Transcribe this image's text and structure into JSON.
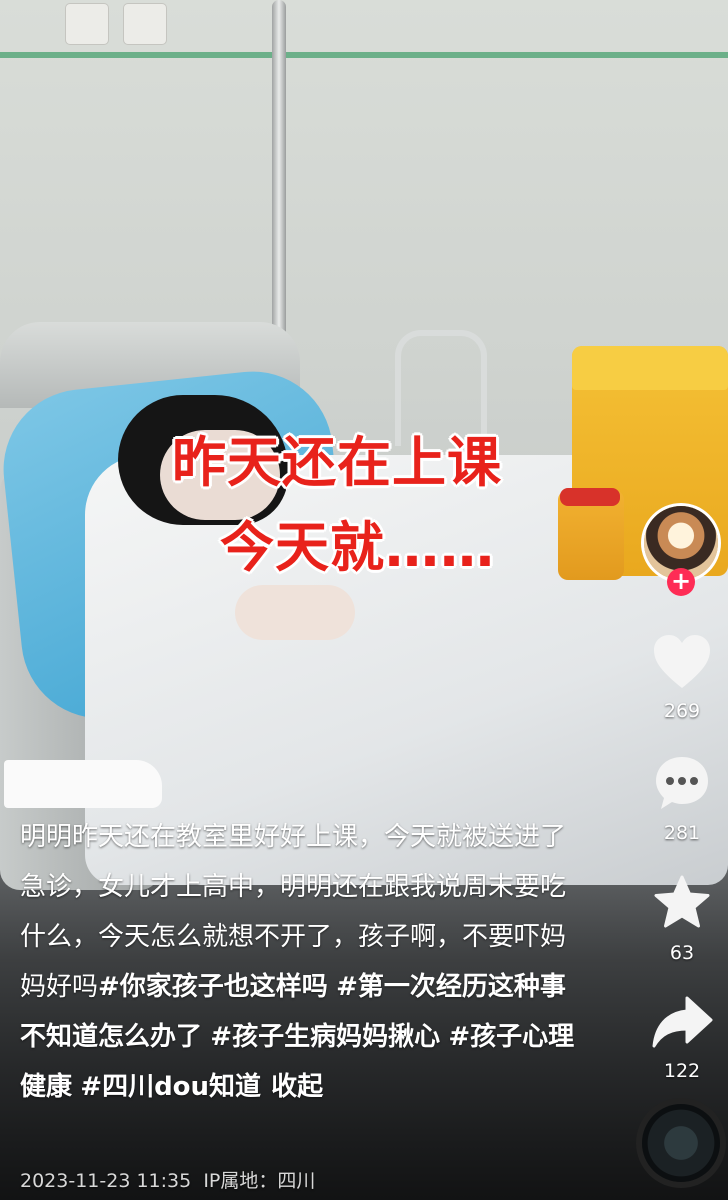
{
  "video": {
    "overlay_line1": "昨天还在上课",
    "overlay_line2": "今天就……"
  },
  "author": {
    "avatar_icon": "author-avatar",
    "follow_icon": "plus"
  },
  "actions": {
    "likes": "269",
    "comments": "281",
    "favorites": "63",
    "shares": "122"
  },
  "caption": {
    "text": "明明昨天还在教室里好好上课，今天就被送进了急诊，女儿才上高中，明明还在跟我说周末要吃什么，今天怎么就想不开了，孩子啊，不要吓妈妈好吗",
    "tags": [
      "#你家孩子也这样吗",
      "#第一次经历这种事不知道怎么办了",
      "#孩子生病妈妈揪心",
      "#孩子心理健康",
      "#四川dou知道"
    ],
    "collapse_label": "收起"
  },
  "meta": {
    "timestamp": "2023-11-23 11:35",
    "ip_location": "IP属地：四川"
  },
  "colors": {
    "accent": "#fe2c55",
    "overlay_red": "#e8221b"
  }
}
